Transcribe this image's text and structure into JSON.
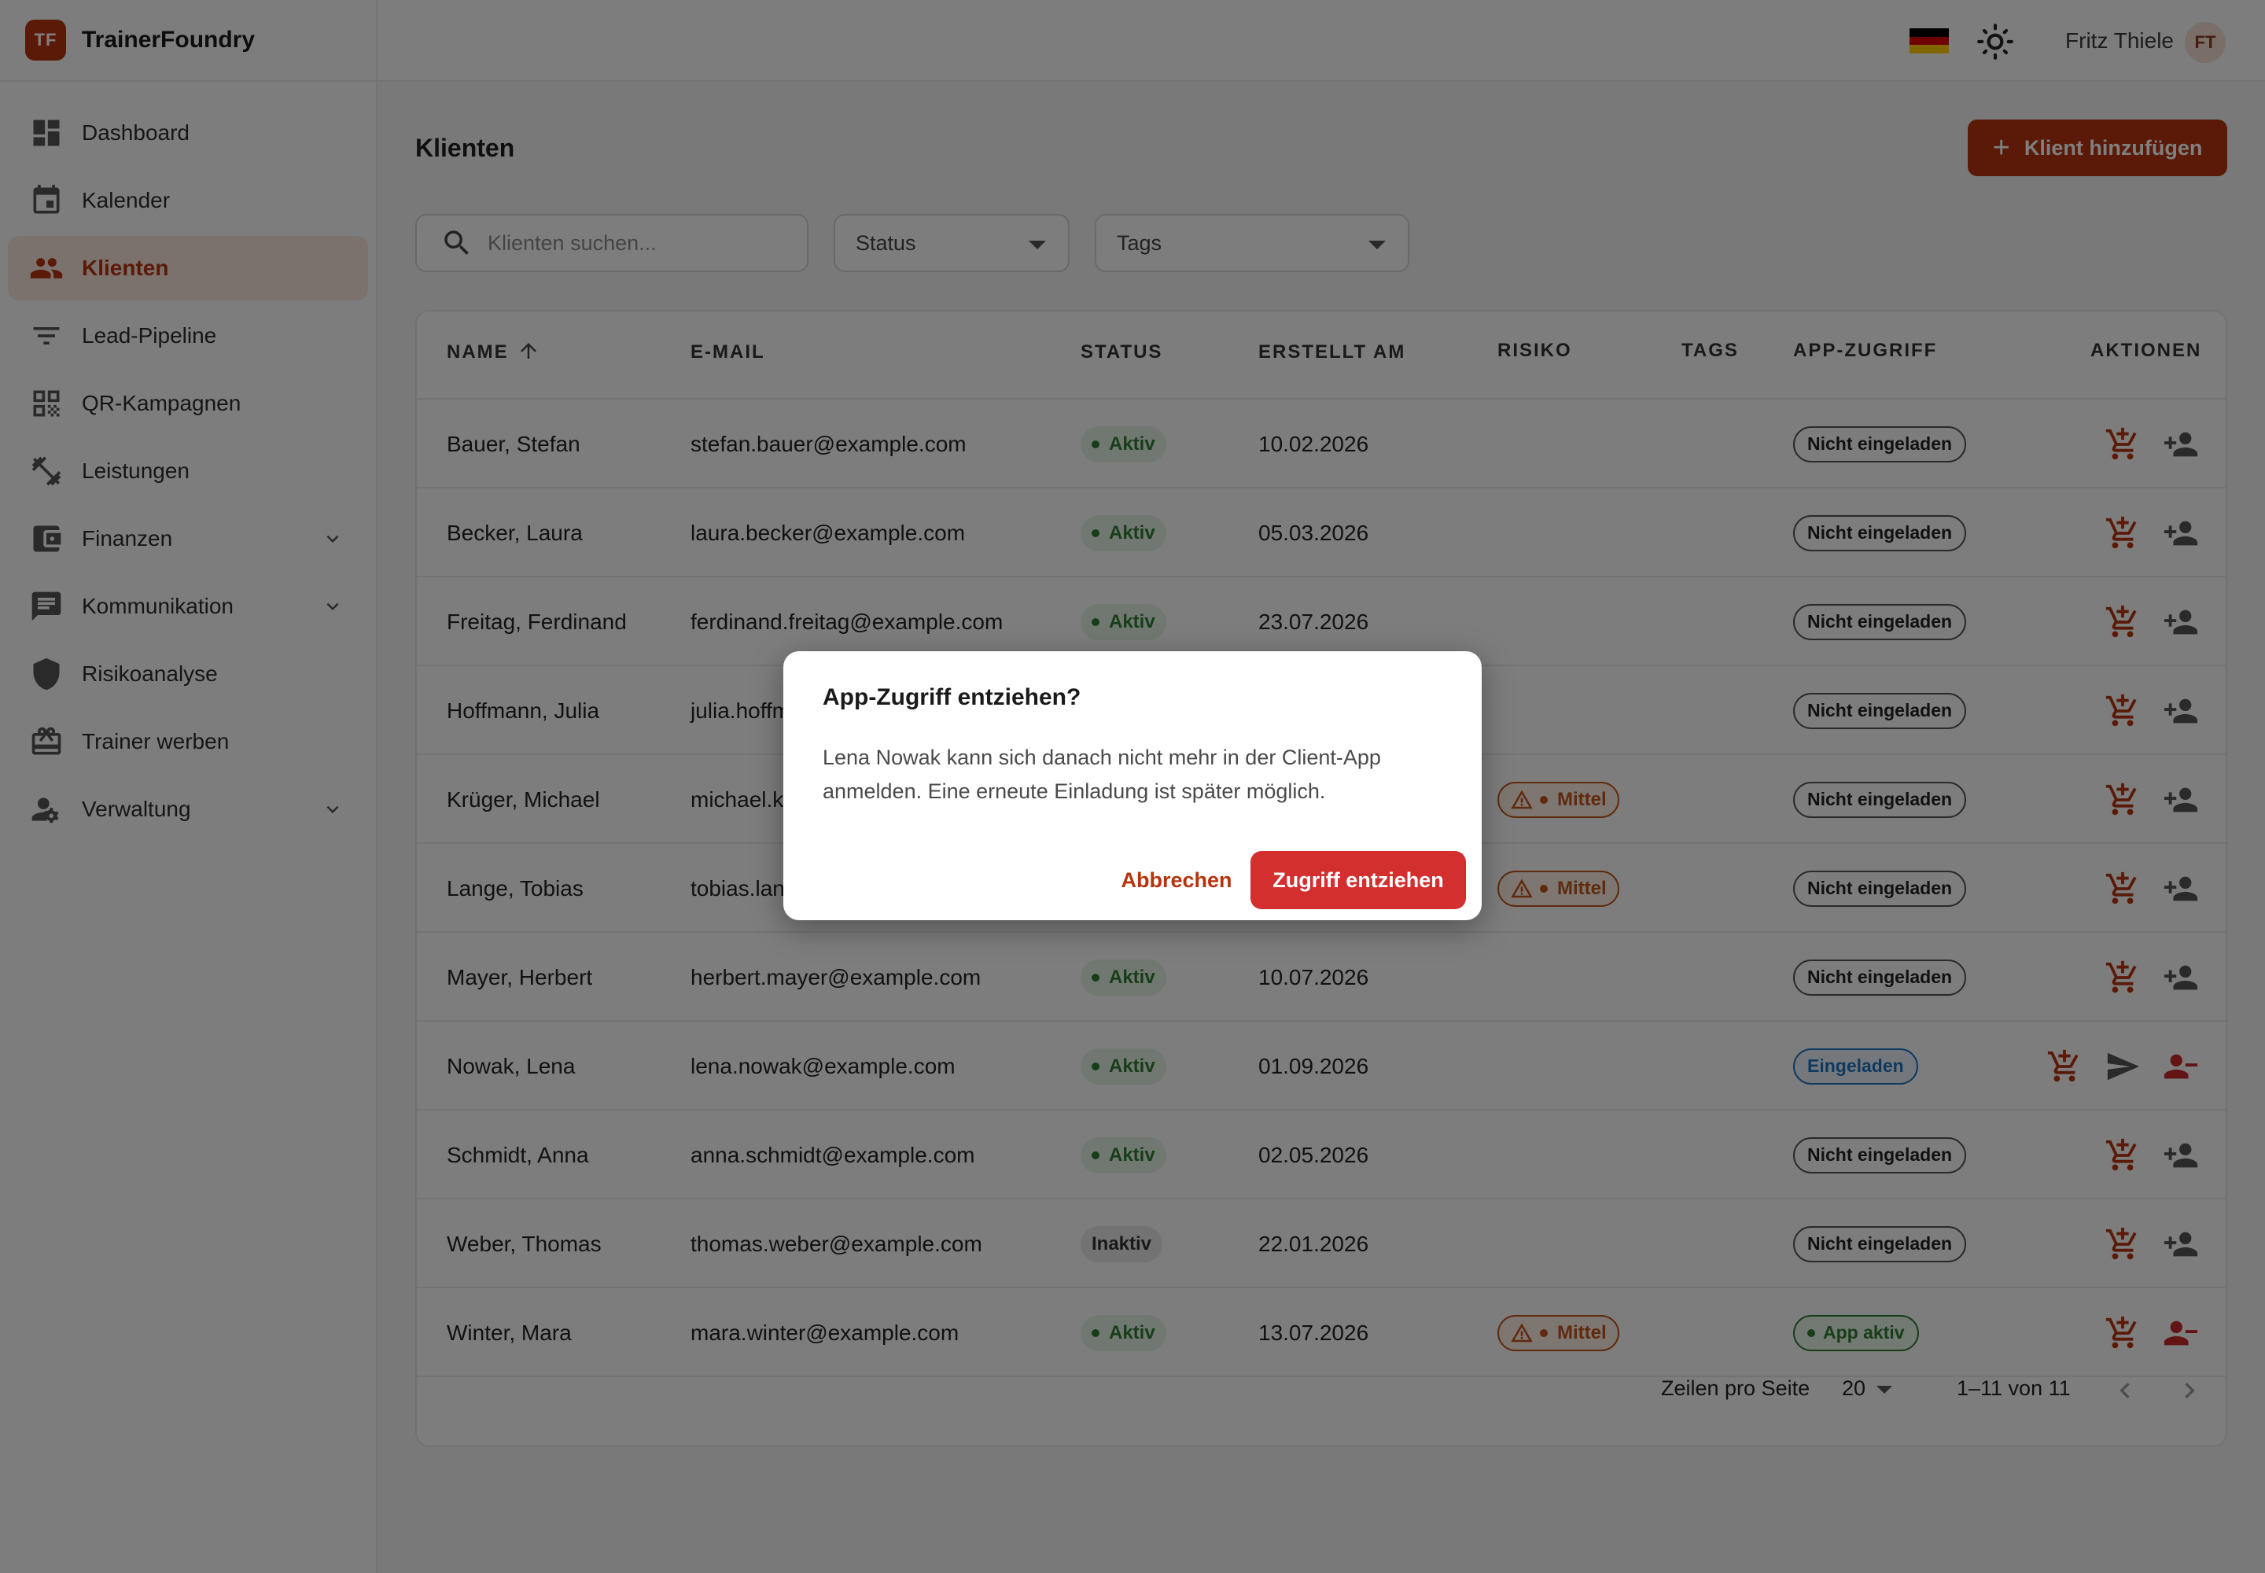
{
  "app": {
    "logo": "TF",
    "name": "TrainerFoundry"
  },
  "topbar": {
    "user_name": "Fritz Thiele",
    "avatar_initials": "FT",
    "language_flag": "de-flag",
    "theme_icon": "sun-icon"
  },
  "sidebar": {
    "items": [
      {
        "label": "Dashboard",
        "icon": "dashboard-icon"
      },
      {
        "label": "Kalender",
        "icon": "calendar-icon"
      },
      {
        "label": "Klienten",
        "icon": "people-icon",
        "active": true
      },
      {
        "label": "Lead-Pipeline",
        "icon": "filter-icon"
      },
      {
        "label": "QR-Kampagnen",
        "icon": "qr-code-icon"
      },
      {
        "label": "Leistungen",
        "icon": "dumbbell-icon"
      },
      {
        "label": "Finanzen",
        "icon": "wallet-icon",
        "expandable": true
      },
      {
        "label": "Kommunikation",
        "icon": "chat-icon",
        "expandable": true
      },
      {
        "label": "Risikoanalyse",
        "icon": "shield-icon"
      },
      {
        "label": "Trainer werben",
        "icon": "gift-icon"
      },
      {
        "label": "Verwaltung",
        "icon": "admin-icon",
        "expandable": true
      }
    ]
  },
  "main": {
    "title": "Klienten",
    "add_button": "Klient hinzufügen",
    "search_placeholder": "Klienten suchen...",
    "status_filter": "Status",
    "tags_filter": "Tags"
  },
  "table": {
    "columns": [
      "NAME",
      "E-MAIL",
      "STATUS",
      "ERSTELLT AM",
      "RISIKO",
      "TAGS",
      "APP-ZUGRIFF",
      "AKTIONEN"
    ],
    "rows": [
      {
        "name": "Bauer, Stefan",
        "email": "stefan.bauer@example.com",
        "status": "Aktiv",
        "created": "10.02.2026",
        "risk": "",
        "app": "Nicht eingeladen"
      },
      {
        "name": "Becker, Laura",
        "email": "laura.becker@example.com",
        "status": "Aktiv",
        "created": "05.03.2026",
        "risk": "",
        "app": "Nicht eingeladen"
      },
      {
        "name": "Freitag, Ferdinand",
        "email": "ferdinand.freitag@example.com",
        "status": "Aktiv",
        "created": "23.07.2026",
        "risk": "",
        "app": "Nicht eingeladen"
      },
      {
        "name": "Hoffmann, Julia",
        "email": "julia.hoffmann@example.com",
        "status": "",
        "created": "",
        "risk": "",
        "app": "Nicht eingeladen"
      },
      {
        "name": "Krüger, Michael",
        "email": "michael.krueger@example.com",
        "status": "",
        "created": "",
        "risk": "Mittel",
        "app": "Nicht eingeladen"
      },
      {
        "name": "Lange, Tobias",
        "email": "tobias.lange@example.com",
        "status": "",
        "created": "",
        "risk": "Mittel",
        "app": "Nicht eingeladen"
      },
      {
        "name": "Mayer, Herbert",
        "email": "herbert.mayer@example.com",
        "status": "Aktiv",
        "created": "10.07.2026",
        "risk": "",
        "app": "Nicht eingeladen"
      },
      {
        "name": "Nowak, Lena",
        "email": "lena.nowak@example.com",
        "status": "Aktiv",
        "created": "01.09.2026",
        "risk": "",
        "app": "Eingeladen"
      },
      {
        "name": "Schmidt, Anna",
        "email": "anna.schmidt@example.com",
        "status": "Aktiv",
        "created": "02.05.2026",
        "risk": "",
        "app": "Nicht eingeladen"
      },
      {
        "name": "Weber, Thomas",
        "email": "thomas.weber@example.com",
        "status": "Inaktiv",
        "created": "22.01.2026",
        "risk": "",
        "app": "Nicht eingeladen"
      },
      {
        "name": "Winter, Mara",
        "email": "mara.winter@example.com",
        "status": "Aktiv",
        "created": "13.07.2026",
        "risk": "Mittel",
        "app": "App aktiv"
      }
    ]
  },
  "pagination": {
    "rows_label": "Zeilen pro Seite",
    "rows_value": "20",
    "range": "1–11 von 11"
  },
  "dialog": {
    "title": "App-Zugriff entziehen?",
    "text": "Lena Nowak kann sich danach nicht mehr in der Client-App anmelden. Eine erneute Einladung ist später möglich.",
    "cancel": "Abbrechen",
    "confirm": "Zugriff entziehen"
  },
  "colors": {
    "accent": "#b5340e",
    "danger": "#d32f2f",
    "success": "#2e7d32",
    "info": "#1e73be",
    "warning": "#c0541a"
  }
}
